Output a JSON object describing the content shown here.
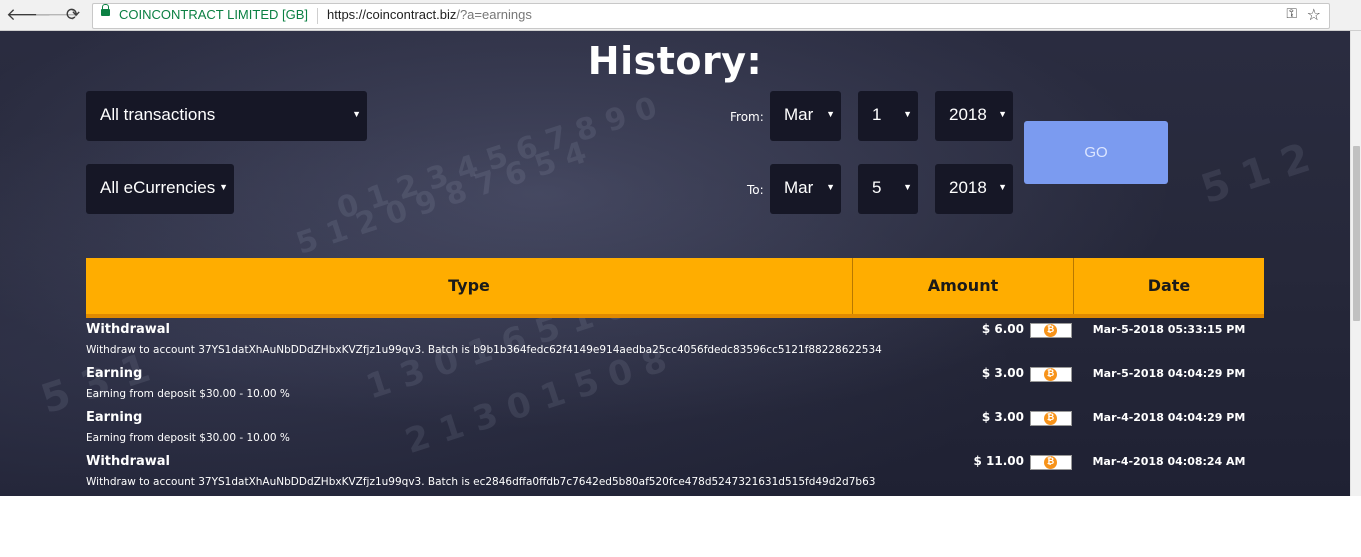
{
  "browser": {
    "cert_label": "COINCONTRACT LIMITED [GB]",
    "url_main": "https://coincontract.biz",
    "url_path": "/?a=earnings"
  },
  "page": {
    "title": "History:",
    "filters": {
      "type_select": "All transactions",
      "currency_select": "All eCurrencies",
      "from_label": "From:",
      "to_label": "To:",
      "from": {
        "month": "Mar",
        "day": "1",
        "year": "2018"
      },
      "to": {
        "month": "Mar",
        "day": "5",
        "year": "2018"
      },
      "go_label": "GO"
    },
    "table": {
      "headers": {
        "type": "Type",
        "amount": "Amount",
        "date": "Date"
      },
      "rows": [
        {
          "type": "Withdrawal",
          "amount": "$ 6.00",
          "date": "Mar-5-2018 05:33:15 PM",
          "desc": "Withdraw to account 37YS1datXhAuNbDDdZHbxKVZfjz1u99qv3. Batch is b9b1b364fedc62f4149e914aedba25cc4056fdedc83596cc5121f88228622534"
        },
        {
          "type": "Earning",
          "amount": "$ 3.00",
          "date": "Mar-5-2018 04:04:29 PM",
          "desc": "Earning from deposit $30.00 - 10.00 %"
        },
        {
          "type": "Earning",
          "amount": "$ 3.00",
          "date": "Mar-4-2018 04:04:29 PM",
          "desc": "Earning from deposit $30.00 - 10.00 %"
        },
        {
          "type": "Withdrawal",
          "amount": "$ 11.00",
          "date": "Mar-4-2018 04:08:24 AM",
          "desc": "Withdraw to account 37YS1datXhAuNbDDdZHbxKVZfjz1u99qv3. Batch is ec2846dffa0ffdb7c7642ed5b80af520fce478d5247321631d515fd49d2d7b63"
        }
      ]
    }
  },
  "colors": {
    "accent": "#ffad00",
    "go_button": "#7b9bf0",
    "bitcoin": "#f7931a"
  },
  "icons": [
    "back-arrow-icon",
    "forward-arrow-icon",
    "reload-icon",
    "lock-icon",
    "key-icon",
    "star-icon",
    "bitcoin-icon",
    "chevron-down-icon"
  ]
}
